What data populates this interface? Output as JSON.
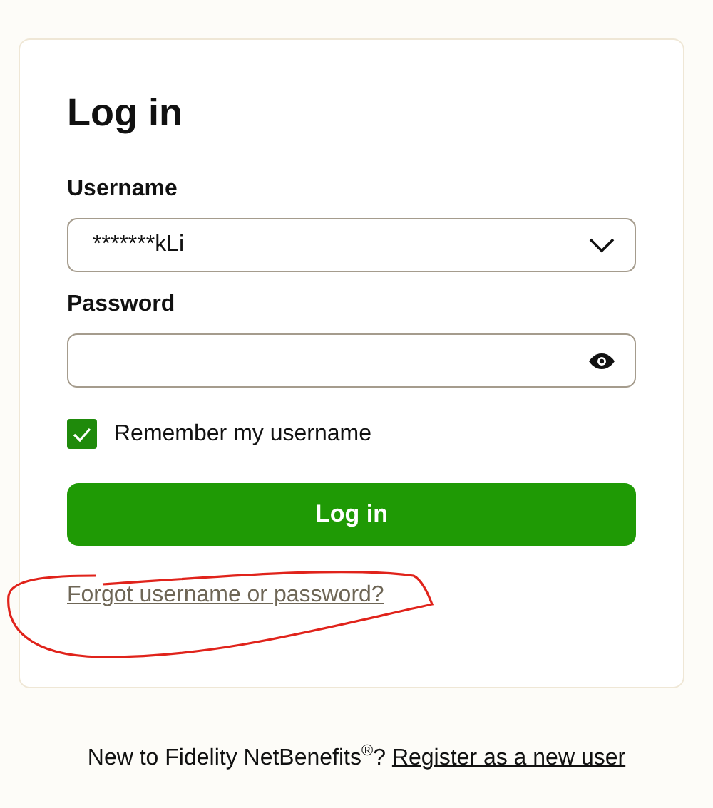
{
  "title": "Log in",
  "username": {
    "label": "Username",
    "value": "*******kLi"
  },
  "password": {
    "label": "Password"
  },
  "remember": {
    "label": "Remember my username",
    "checked": true
  },
  "login_button": "Log in",
  "forgot_link": "Forgot username or password?",
  "footer": {
    "text": "New to Fidelity NetBenefits$^{®}$? ",
    "link": "Register as a new user"
  }
}
